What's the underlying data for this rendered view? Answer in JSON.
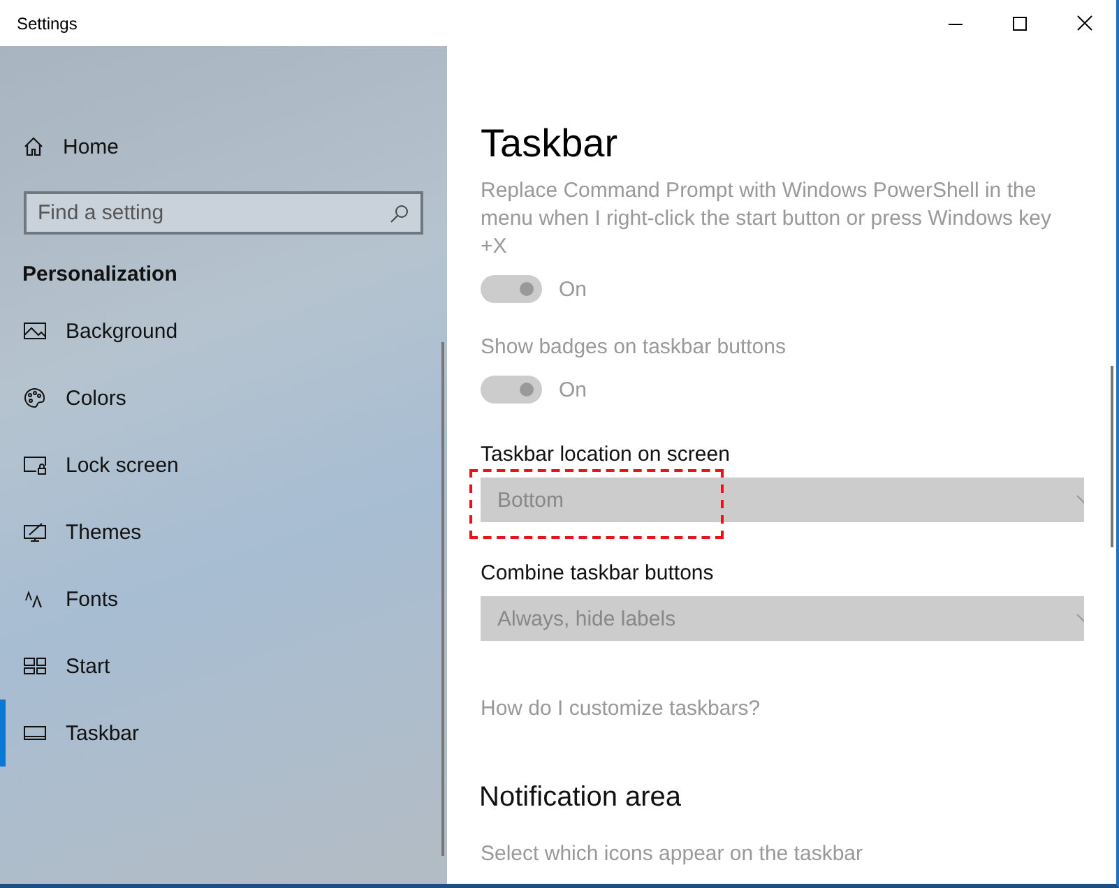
{
  "window": {
    "title": "Settings"
  },
  "sidebar": {
    "home": "Home",
    "search": {
      "placeholder": "Find a setting"
    },
    "section": "Personalization",
    "items": [
      {
        "label": "Background",
        "selected": false
      },
      {
        "label": "Colors",
        "selected": false
      },
      {
        "label": "Lock screen",
        "selected": false
      },
      {
        "label": "Themes",
        "selected": false
      },
      {
        "label": "Fonts",
        "selected": false
      },
      {
        "label": "Start",
        "selected": false
      },
      {
        "label": "Taskbar",
        "selected": true
      }
    ]
  },
  "content": {
    "title": "Taskbar",
    "settings": [
      {
        "kind": "toggle",
        "label": "Replace Command Prompt with Windows PowerShell in the menu when I right-click the start button or press Windows key +X",
        "on": true,
        "disabled": true,
        "state": "On"
      },
      {
        "kind": "toggle",
        "label": "Show badges on taskbar buttons",
        "on": true,
        "disabled": true,
        "state": "On"
      },
      {
        "kind": "dropdown",
        "label": "Taskbar location on screen",
        "value": "Bottom",
        "disabled": true,
        "highlighted": true
      },
      {
        "kind": "dropdown",
        "label": "Combine taskbar buttons",
        "value": "Always, hide labels",
        "disabled": true,
        "highlighted": false
      }
    ],
    "link": "How do I customize taskbars?",
    "section": "Notification area",
    "section_link": "Select which icons appear on the taskbar"
  }
}
